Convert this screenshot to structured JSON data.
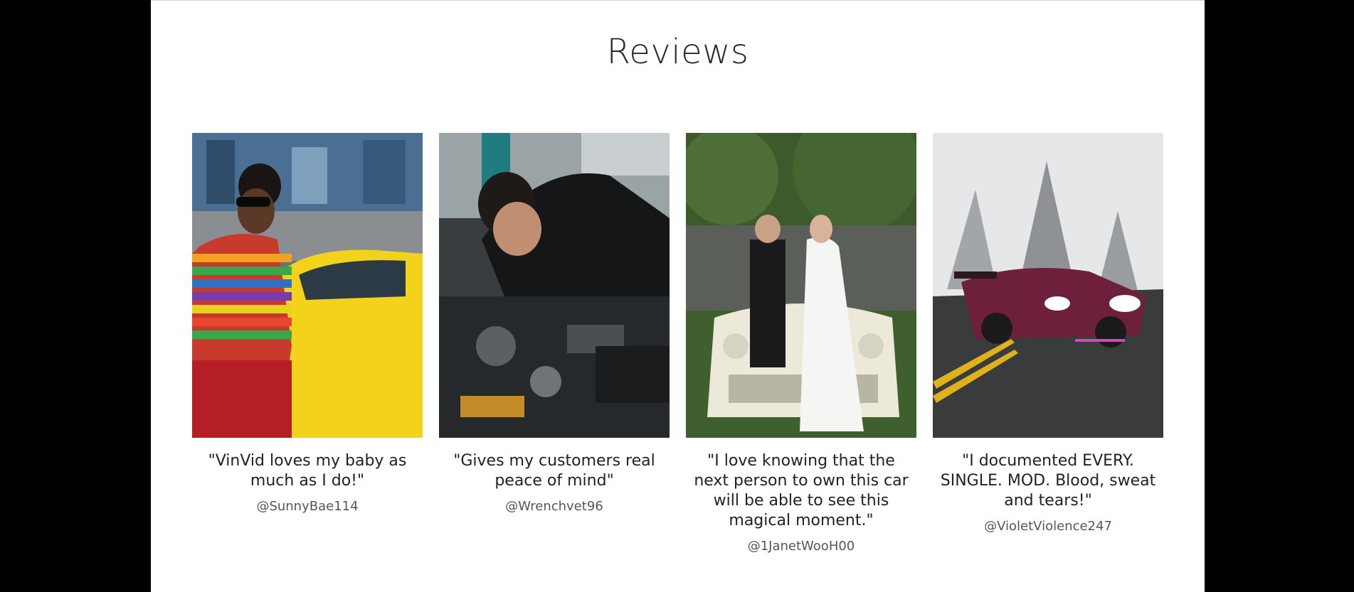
{
  "section": {
    "title": "Reviews"
  },
  "reviews": [
    {
      "quote": "\"VinVid loves my baby as much as I do!\"",
      "handle": "@SunnyBae114",
      "photo_subject": "person-with-yellow-car"
    },
    {
      "quote": "\"Gives my customers real peace of mind\"",
      "handle": "@Wrenchvet96",
      "photo_subject": "mechanic-working-on-engine"
    },
    {
      "quote": "\"I love knowing that the next person to own this car will be able to see this magical moment.\"",
      "handle": "@1JanetWooH00",
      "photo_subject": "wedding-couple-on-vintage-car"
    },
    {
      "quote": "\"I documented EVERY. SINGLE. MOD. Blood, sweat and tears!\"",
      "handle": "@VioletViolence247",
      "photo_subject": "modified-car-on-foggy-road"
    }
  ],
  "colors": {
    "background": "#000000",
    "panel": "#ffffff",
    "title_text": "#2a2a2a",
    "quote_text": "#222222",
    "handle_text": "#555555"
  }
}
